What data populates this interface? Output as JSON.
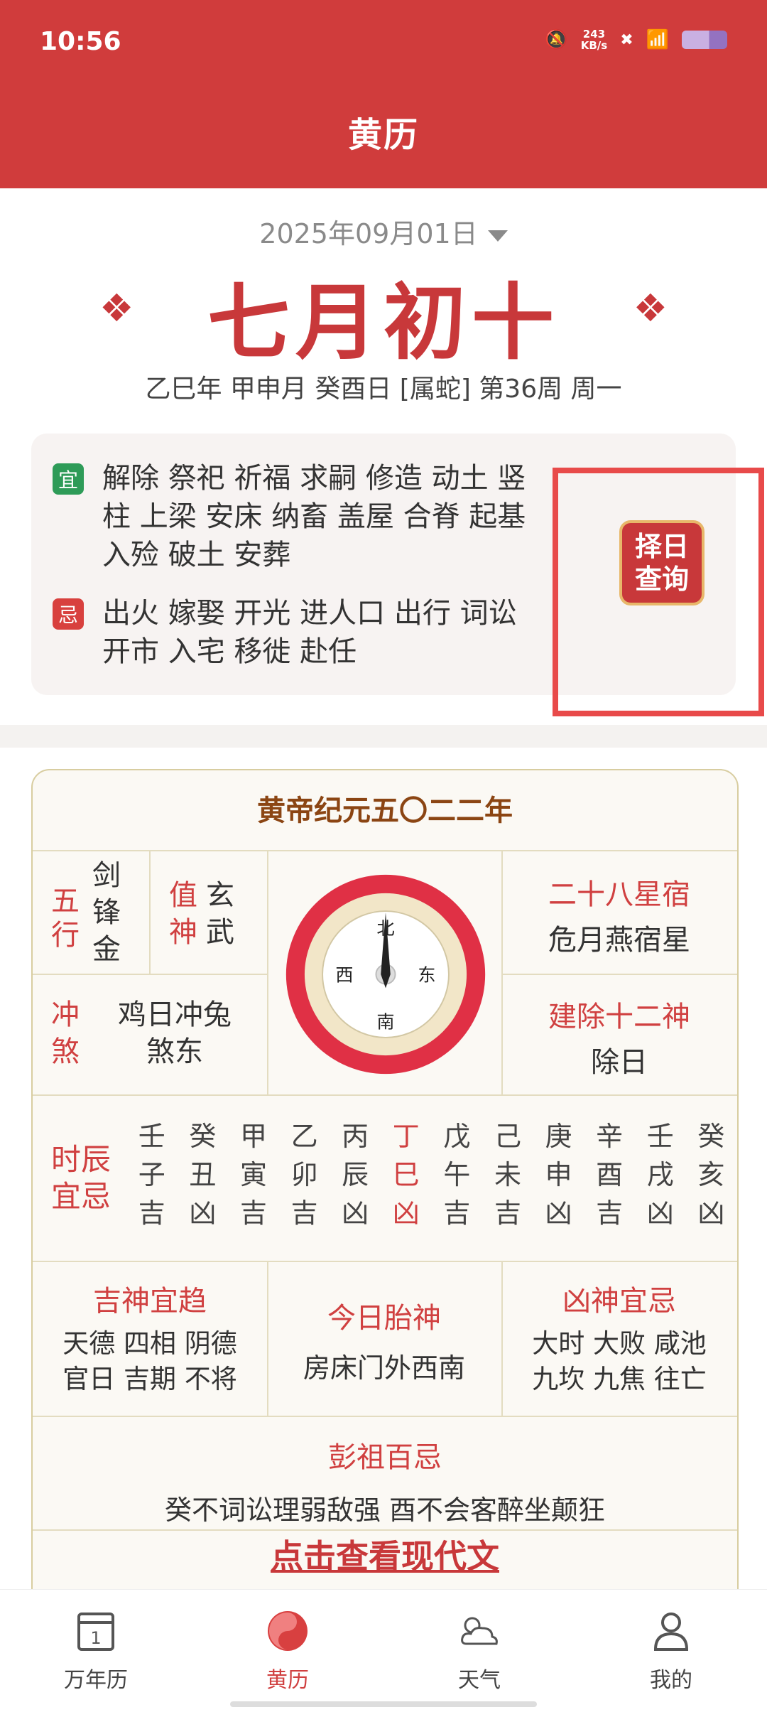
{
  "status": {
    "time": "10:56",
    "net_speed_top": "243",
    "net_speed_bottom": "KB/s"
  },
  "header": {
    "title": "黄历"
  },
  "date": {
    "solar": "2025年09月01日",
    "lunar": "七月初十",
    "ganzhi": "乙巳年 甲申月 癸酉日 [属蛇] 第36周 周一"
  },
  "yiji": {
    "yi_badge": "宜",
    "yi_text": "解除 祭祀 祈福 求嗣 修造 动土 竖柱 上梁 安床 纳畜 盖屋 合脊 起基 入殓 破土 安葬",
    "ji_badge": "忌",
    "ji_text": "出火 嫁娶 开光 进人口 出行 词讼 开市 入宅 移徙 赴任",
    "query_line1": "择日",
    "query_line2": "查询"
  },
  "almanac": {
    "era": "黄帝纪元五〇二二年",
    "wuxing_label": [
      "五",
      "行"
    ],
    "wuxing_value": [
      "剑",
      "锋",
      "金"
    ],
    "zhishen_label": [
      "值",
      "神"
    ],
    "zhishen_value": [
      "玄",
      "武"
    ],
    "xingxiu_title": "二十八星宿",
    "xingxiu_value": "危月燕宿星",
    "chongsha_label": [
      "冲",
      "煞"
    ],
    "chongsha_value1": "鸡日冲兔",
    "chongsha_value2": "煞东",
    "jianchu_title": "建除十二神",
    "jianchu_value": "除日",
    "compass": {
      "north": "北",
      "south": "南",
      "east": "东",
      "west": "西"
    },
    "shichen_label": [
      "时辰",
      "宜忌"
    ],
    "shichen": [
      {
        "gan": "壬",
        "zhi": "子",
        "luck": "吉"
      },
      {
        "gan": "癸",
        "zhi": "丑",
        "luck": "凶"
      },
      {
        "gan": "甲",
        "zhi": "寅",
        "luck": "吉"
      },
      {
        "gan": "乙",
        "zhi": "卯",
        "luck": "吉"
      },
      {
        "gan": "丙",
        "zhi": "辰",
        "luck": "凶"
      },
      {
        "gan": "丁",
        "zhi": "巳",
        "luck": "凶"
      },
      {
        "gan": "戊",
        "zhi": "午",
        "luck": "吉"
      },
      {
        "gan": "己",
        "zhi": "未",
        "luck": "吉"
      },
      {
        "gan": "庚",
        "zhi": "申",
        "luck": "凶"
      },
      {
        "gan": "辛",
        "zhi": "酉",
        "luck": "吉"
      },
      {
        "gan": "壬",
        "zhi": "戌",
        "luck": "凶"
      },
      {
        "gan": "癸",
        "zhi": "亥",
        "luck": "凶"
      }
    ],
    "jishen_title": "吉神宜趋",
    "jishen_line1": "天德 四相 阴德",
    "jishen_line2": "官日 吉期 不将",
    "taishen_title": "今日胎神",
    "taishen_value": "房床门外西南",
    "xiongshen_title": "凶神宜忌",
    "xiongshen_line1": "大时 大败 咸池",
    "xiongshen_line2": "九坎 九焦 往亡",
    "pengzu_title": "彭祖百忌",
    "pengzu_value": "癸不词讼理弱敌强 酉不会客醉坐颠狂",
    "modern_link": "点击查看现代文"
  },
  "tabs": [
    {
      "label": "万年历",
      "icon": "calendar-icon"
    },
    {
      "label": "黄历",
      "icon": "yin-yang-icon"
    },
    {
      "label": "天气",
      "icon": "weather-icon"
    },
    {
      "label": "我的",
      "icon": "user-icon"
    }
  ],
  "colors": {
    "brand_red": "#d03c3c",
    "yi_green": "#2e9b58",
    "ji_red": "#d8403e"
  }
}
